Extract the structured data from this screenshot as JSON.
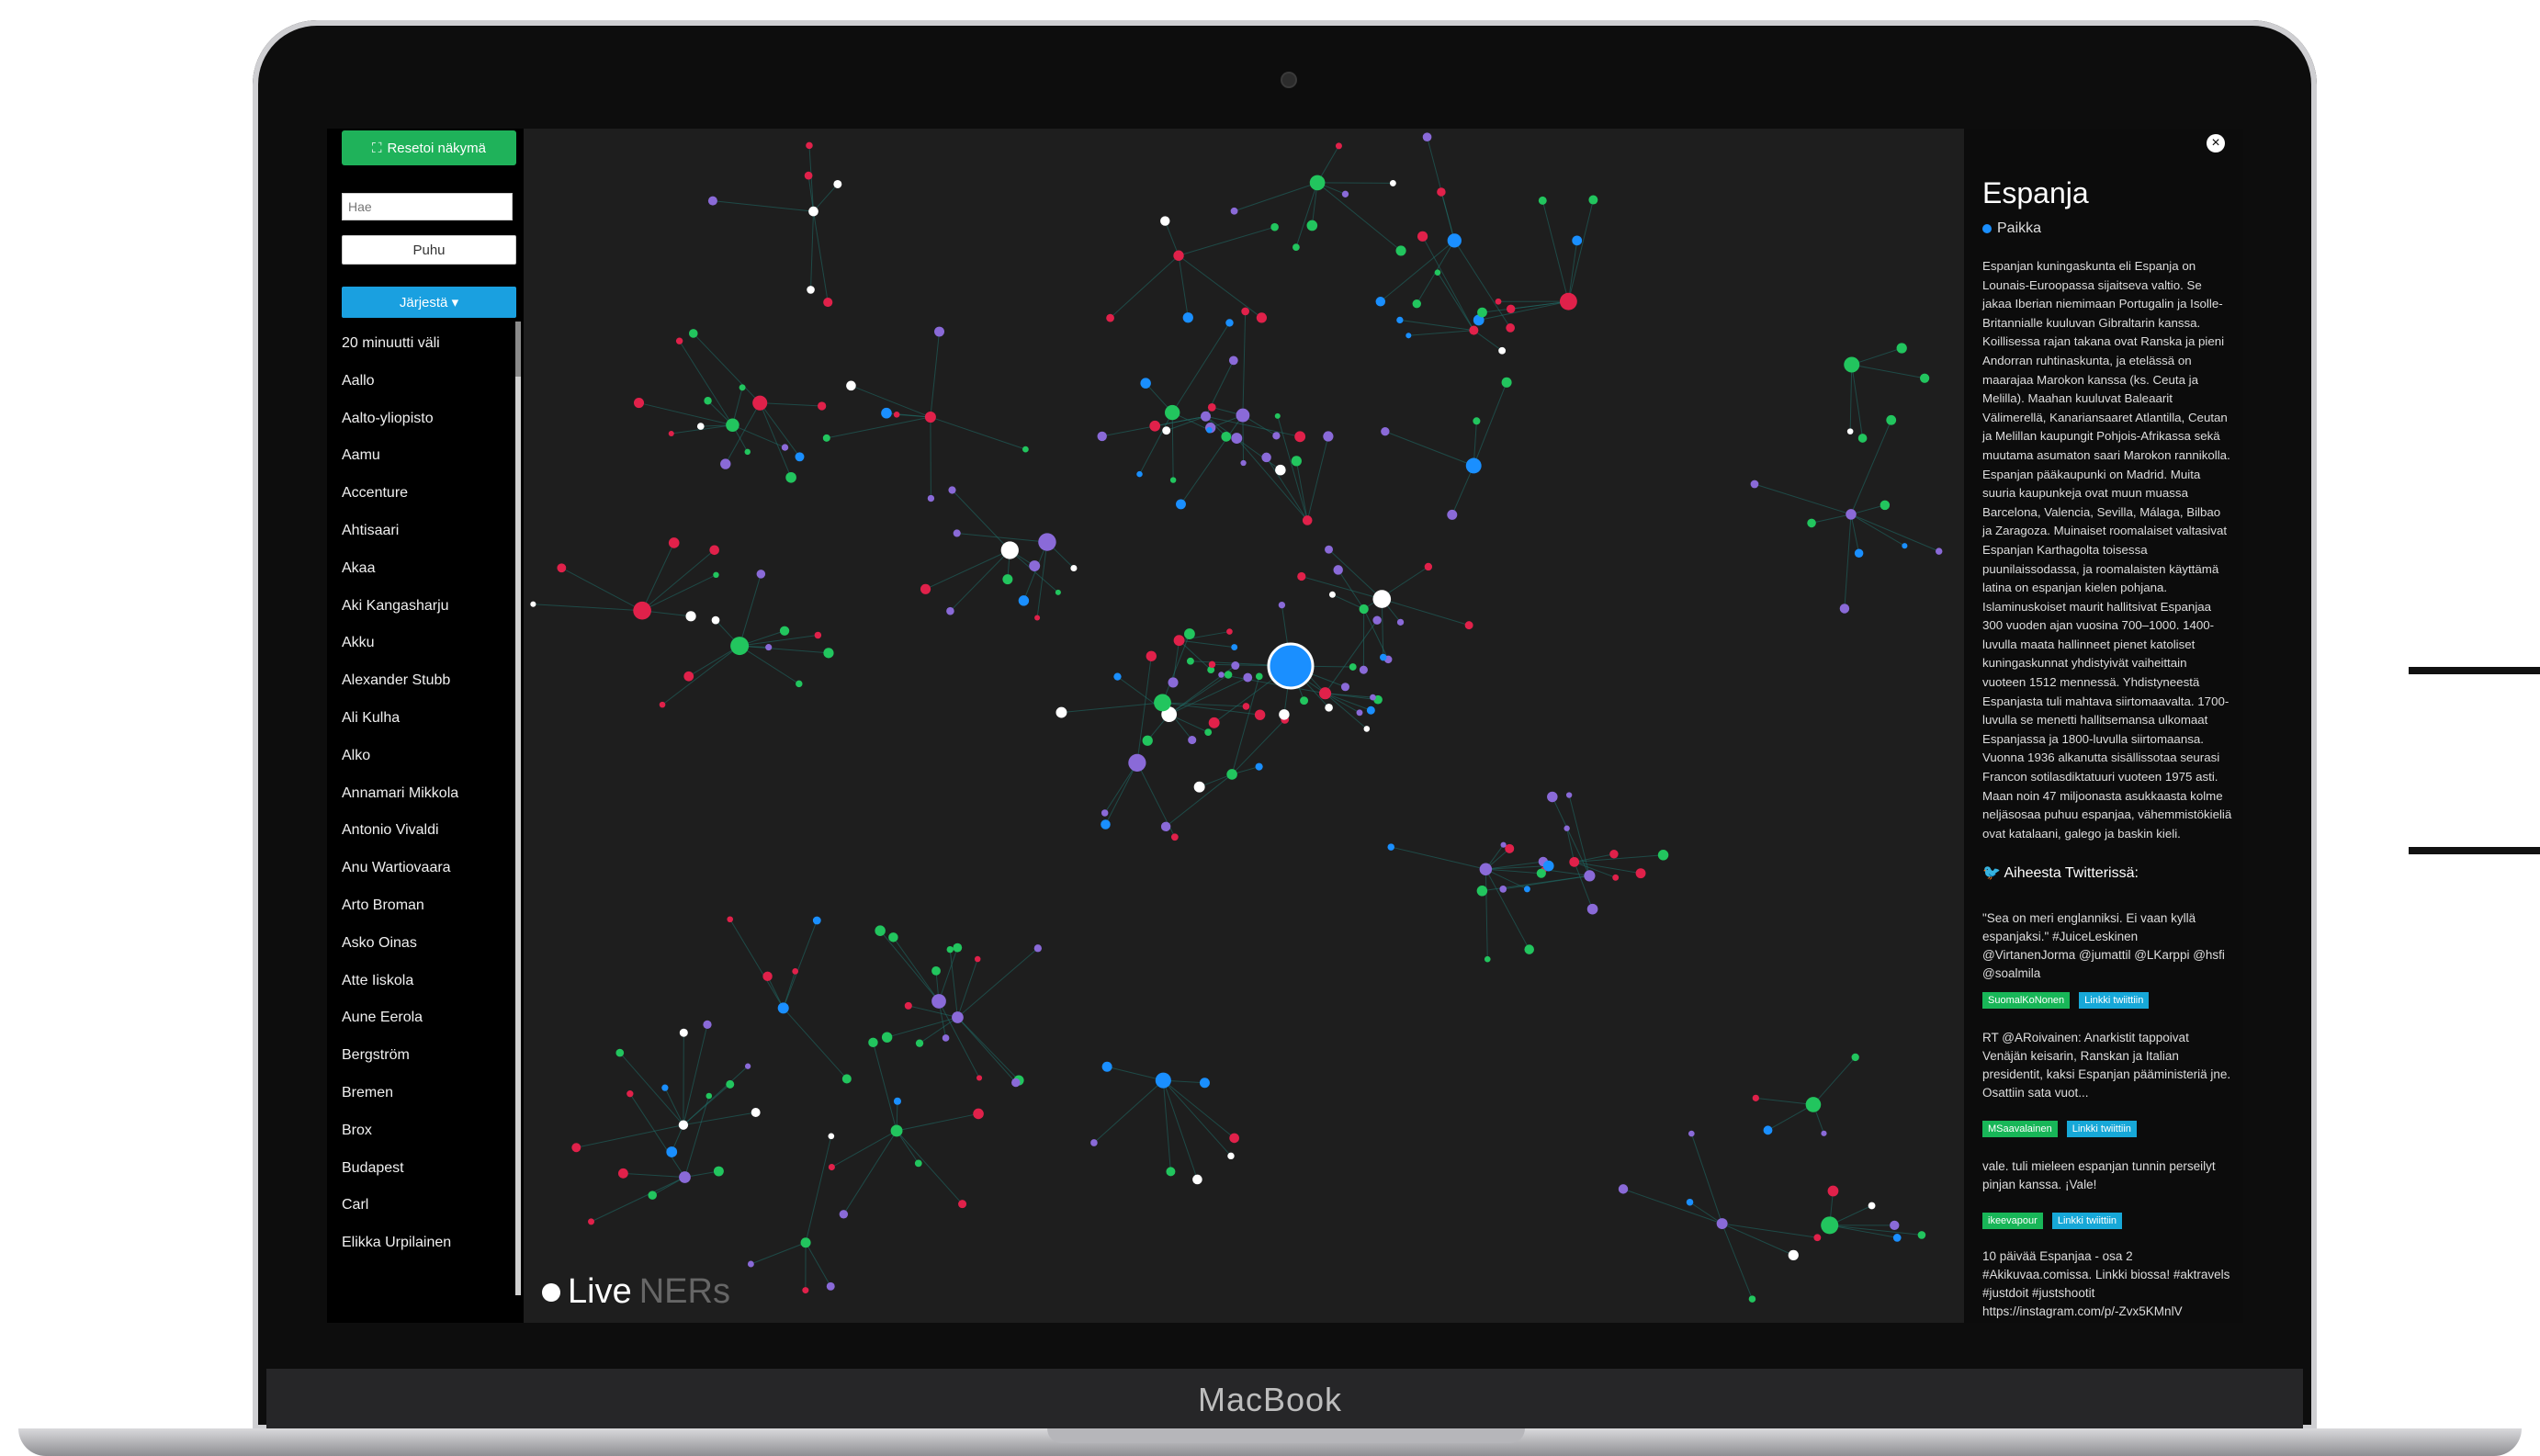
{
  "device": {
    "brand": "MacBook"
  },
  "sidebar": {
    "reset_label": "Resetoi näkymä",
    "search_placeholder": "Hae",
    "talk_label": "Puhu",
    "sort_label": "Järjestä",
    "items": [
      "20 minuutti väli",
      "Aallo",
      "Aalto-yliopisto",
      "Aamu",
      "Accenture",
      "Ahtisaari",
      "Akaa",
      "Aki Kangasharju",
      "Akku",
      "Alexander Stubb",
      "Ali Kulha",
      "Alko",
      "Annamari Mikkola",
      "Antonio Vivaldi",
      "Anu Wartiovaara",
      "Arto Broman",
      "Asko Oinas",
      "Atte Iiskola",
      "Aune Eerola",
      "Bergström",
      "Bremen",
      "Brox",
      "Budapest",
      "Carl",
      "Elikka Urpilainen"
    ]
  },
  "graph": {
    "logo_live": "Live",
    "logo_ners": "NERs",
    "colors": {
      "place": "#1a8fff",
      "person": "#e0214a",
      "org": "#22c55e",
      "document": "#8a6ad8",
      "other": "#ffffff",
      "edge": "#1f6f6a"
    }
  },
  "panel": {
    "close_icon": "×",
    "title": "Espanja",
    "type_label": "Paikka",
    "description": "Espanjan kuningaskunta eli Espanja on Lounais-Euroopassa sijaitseva valtio. Se jakaa Iberian niemimaan Portugalin ja Isolle-Britannialle kuuluvan Gibraltarin kanssa. Koillisessa rajan takana ovat Ranska ja pieni Andorran ruhtinaskunta, ja etelässä on maarajaa Marokon kanssa (ks. Ceuta ja Melilla). Maahan kuuluvat Baleaarit Välimerellä, Kanariansaaret Atlantilla, Ceutan ja Melillan kaupungit Pohjois-Afrikassa sekä muutama asumaton saari Marokon rannikolla. Espanjan pääkaupunki on Madrid. Muita suuria kaupunkeja ovat muun muassa Barcelona, Valencia, Sevilla, Málaga, Bilbao ja Zaragoza. Muinaiset roomalaiset valtasivat Espanjan Karthagolta toisessa puunilaissodassa, ja roomalaisten käyttämä latina on espanjan kielen pohjana. Islaminuskoiset maurit hallitsivat Espanjaa 300 vuoden ajan vuosina 700–1000. 1400-luvulla maata hallinneet pienet katoliset kuningaskunnat yhdistyivät vaiheittain vuoteen 1512 mennessä. Yhdistyneestä Espanjasta tuli mahtava siirtomaavalta. 1700-luvulla se menetti hallitsemansa ulkomaat Espanjassa ja 1800-luvulla siirtomaansa. Vuonna 1936 alkanutta sisällissotaa seurasi Francon sotilasdiktatuuri vuoteen 1975 asti. Maan noin 47 miljoonasta asukkaasta kolme neljäsosaa puhuu espanjaa, vähemmistökieliä ovat katalaani, galego ja baskin kieli.",
    "twitter_heading": "Aiheesta Twitterissä:",
    "tweets": [
      {
        "text": "\"Sea on meri englanniksi. Ei vaan kyllä espanjaksi.\" #JuiceLeskinen @VirtanenJorma @jumattil @LKarppi @hsfi @soalmila",
        "user": "SuomalKoNonen",
        "link": "Linkki twiittiin"
      },
      {
        "text": "RT @ARoivainen: Anarkistit tappoivat Venäjän keisarin, Ranskan ja Italian presidentit, kaksi Espanjan pääministeriä jne. Osattiin sata vuot...",
        "user": "MSaavalainen",
        "link": "Linkki twiittiin"
      },
      {
        "text": "vale. tuli mieleen espanjan tunnin perseilyt pinjan kanssa. ¡Vale!",
        "user": "ikeevapour",
        "link": "Linkki twiittiin"
      },
      {
        "text": "10 päivää Espanjaa - osa 2 #Akikuvaa.comissa. Linkki biossa! #aktravels #justdoit #justshootit https://instagram.com/p/-Zvx5KMnlV",
        "user": "",
        "link": ""
      }
    ]
  }
}
